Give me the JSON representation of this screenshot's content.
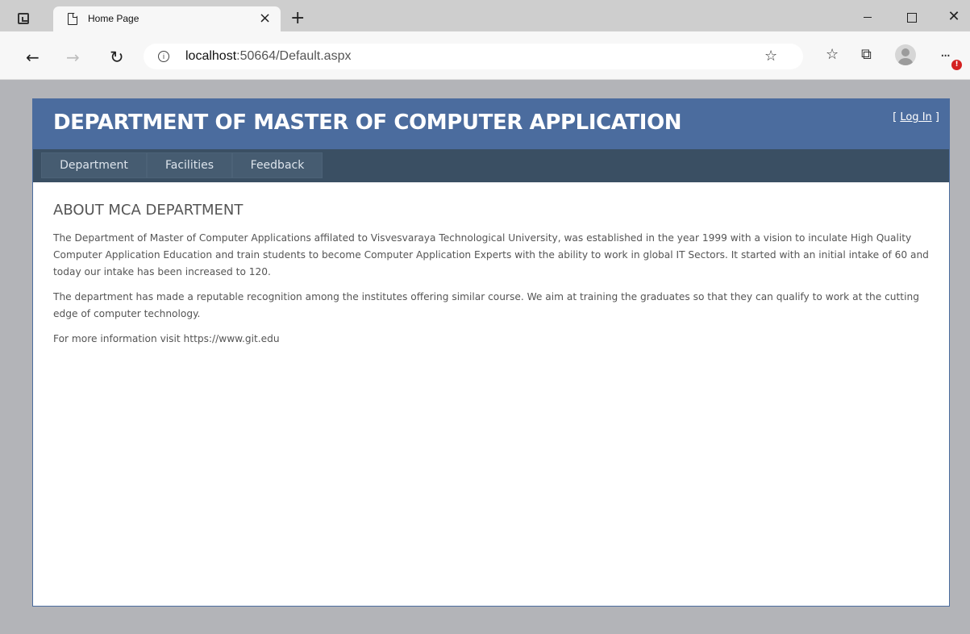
{
  "browser": {
    "tab_title": "Home Page",
    "tab_close": "×",
    "new_tab": "+",
    "url_host": "localhost",
    "url_path": ":50664/Default.aspx",
    "more_badge": "!"
  },
  "site": {
    "title": "DEPARTMENT OF MASTER OF COMPUTER APPLICATION",
    "login_prefix": "[ ",
    "login_label": "Log In",
    "login_suffix": " ]",
    "menu": [
      {
        "label": "Department"
      },
      {
        "label": "Facilities"
      },
      {
        "label": "Feedback"
      }
    ]
  },
  "content": {
    "heading": "ABOUT MCA DEPARTMENT",
    "paragraphs": [
      "The Department of Master of Computer Applications affilated to Visvesvaraya Technological University, was established in the year 1999 with a vision to inculate High Quality Computer Application Education and train students to become Computer Application Experts with the ability to work in global IT Sectors. It started with an initial intake of 60 and today our intake has been increased to 120.",
      "The department has made a reputable recognition among the institutes offering similar course. We aim at training the graduates so that they can qualify to work at the cutting edge of computer technology.",
      "For more information visit https://www.git.edu"
    ]
  },
  "colors": {
    "header_blue": "#4b6c9e",
    "menu_dark": "#3a4f63",
    "menu_item": "#465c71",
    "page_bg": "#b3b4b8"
  },
  "icons": [
    "tab-actions-icon",
    "page-icon",
    "close-icon",
    "plus-icon",
    "minimize-icon",
    "maximize-icon",
    "window-close-icon",
    "back-icon",
    "forward-icon",
    "refresh-icon",
    "info-icon",
    "add-favorite-icon",
    "favorites-icon",
    "collections-icon",
    "profile-icon",
    "more-icon"
  ]
}
